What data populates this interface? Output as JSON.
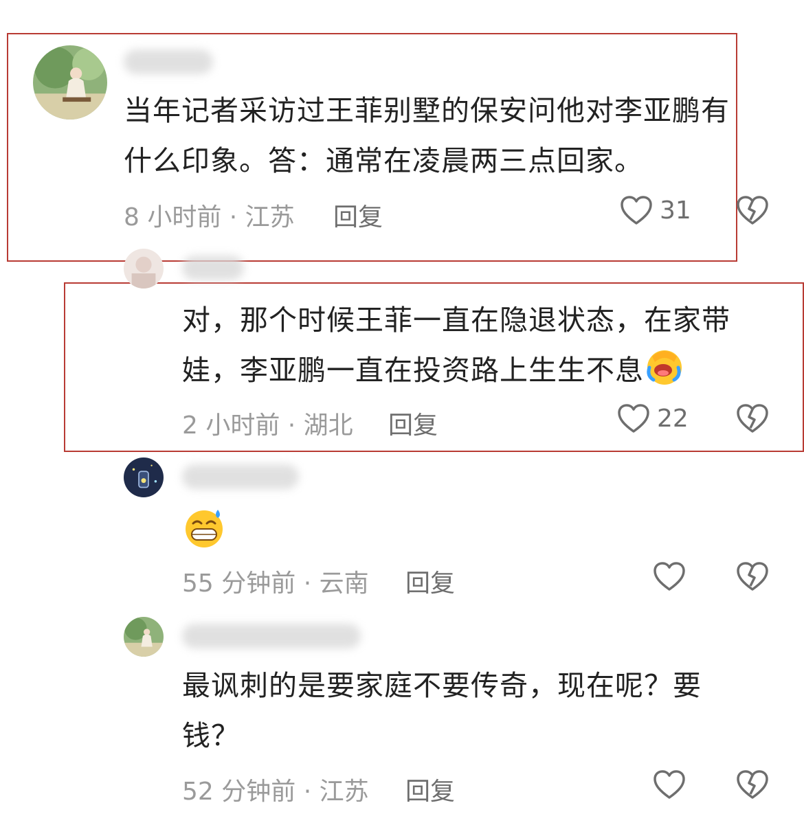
{
  "comments": [
    {
      "text_lines": [
        "当年记者采访过王菲别墅的保安问他对李亚鹏有",
        "什么印象。答：通常在凌晨两三点回家。"
      ],
      "meta": "8 小时前 · 江苏",
      "reply": "回复",
      "likes": "31"
    },
    {
      "text_lines": [
        "对，那个时候王菲一直在隐退状态，在家带",
        "娃，李亚鹏一直在投资路上生生不息"
      ],
      "meta": "2 小时前 · 湖北",
      "reply": "回复",
      "likes": "22"
    },
    {
      "text_lines": [],
      "meta": "55 分钟前 · 云南",
      "reply": "回复",
      "likes": ""
    },
    {
      "text_lines": [
        "最讽刺的是要家庭不要传奇，现在呢？要",
        "钱？"
      ],
      "meta": "52 分钟前 · 江苏",
      "reply": "回复",
      "likes": ""
    }
  ],
  "icons": {
    "like": "heart-outline-icon",
    "dislike": "broken-heart-icon"
  },
  "colors": {
    "highlight_border": "#b83a33",
    "meta_text": "#9a9a9a"
  }
}
